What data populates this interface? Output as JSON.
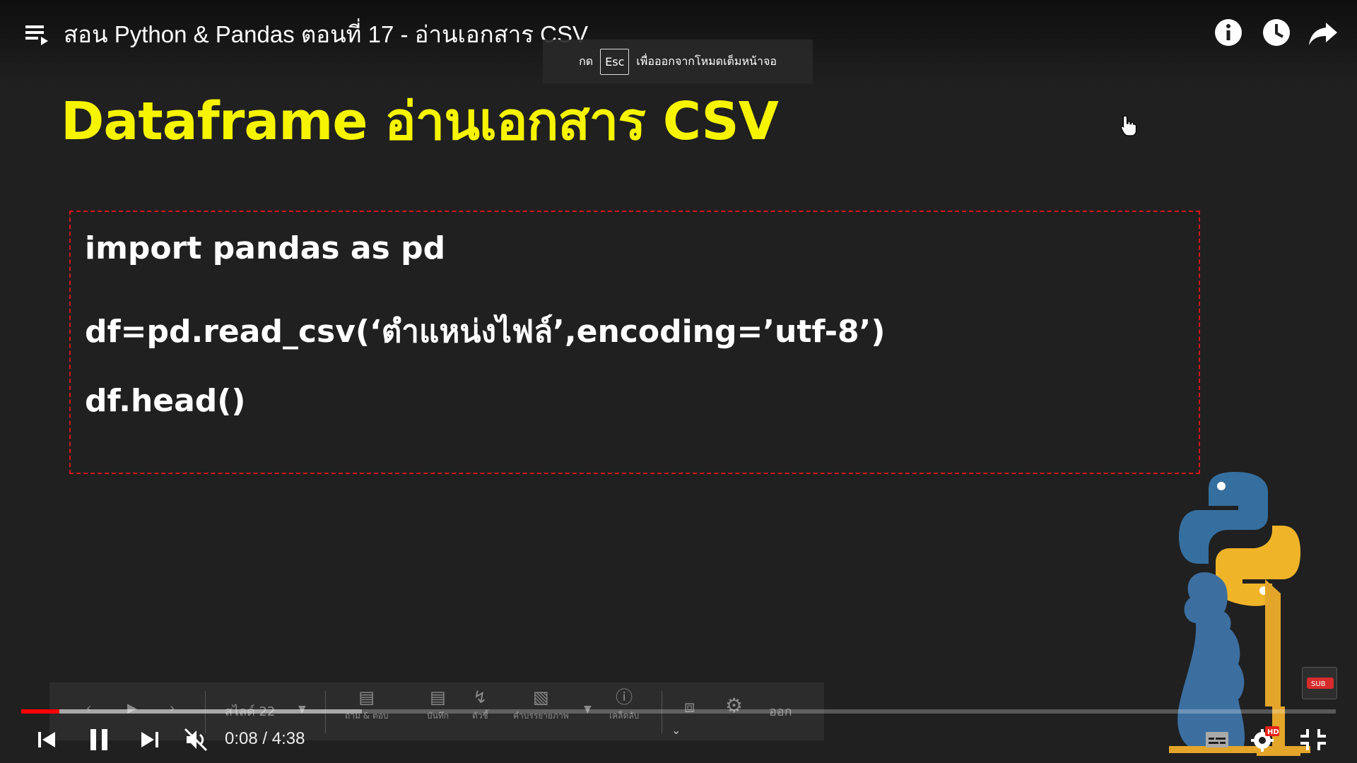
{
  "player": {
    "title": "สอน Python & Pandas ตอนที่ 17 - อ่านเอกสาร CSV",
    "esc_toast": {
      "prefix": "กด",
      "key": "Esc",
      "suffix": "เพื่อออกจากโหมดเต็มหน้าจอ"
    },
    "current_time": "0:08",
    "duration": "4:38",
    "time_display": "0:08 / 4:38",
    "progress_played_fraction": 0.029,
    "progress_loaded_fraction": 0.259,
    "hd_badge": "HD",
    "sub_badge": "SUB",
    "accent_color": "#ff0000"
  },
  "slide": {
    "title": "Dataframe อ่านเอกสาร CSV",
    "title_color": "#f6f400",
    "code_lines": [
      "import pandas as pd",
      "df=pd.read_csv(‘ตำแหน่งไฟล์’,encoding=’utf-8’)",
      "df.head()"
    ],
    "box_border_color": "#d6161c"
  },
  "toolbar": {
    "slide_label": "สไลด์ 22",
    "qa_label": "ถาม & ตอบ",
    "notes_label": "บันทึก",
    "pointer_label": "ตัวชี้",
    "captions_label": "คำบรรยายภาพ",
    "tips_label": "เคล็ดลับ",
    "exit_label": "ออก"
  },
  "icons": {
    "playlist": "playlist-icon",
    "info": "info-icon",
    "watch_later": "clock-icon",
    "share": "share-icon",
    "prev": "skip-previous-icon",
    "pause": "pause-icon",
    "next": "skip-next-icon",
    "mute": "volume-muted-icon",
    "subtitles": "subtitles-icon",
    "settings": "gear-icon",
    "exit_fullscreen": "exit-fullscreen-icon"
  }
}
